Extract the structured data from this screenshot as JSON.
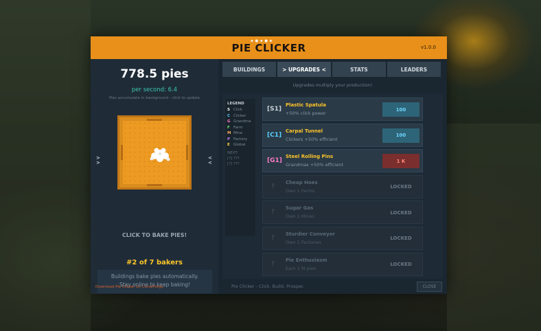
{
  "window": {
    "title": "PIE CLICKER",
    "version": "v1.0.0"
  },
  "left": {
    "pies": "778.5 pies",
    "per_second": "per second: 6.4",
    "background_note": "Pies accumulate in background - click to update",
    "bake_label": "CLICK TO BAKE PIES!",
    "rank": "#2 of 7 bakers",
    "info_line1": "Buildings bake pies automatically.",
    "info_line2": "Stay online to keep baking!"
  },
  "tabs": [
    {
      "label": "BUILDINGS"
    },
    {
      "label": "> UPGRADES <"
    },
    {
      "label": "STATS"
    },
    {
      "label": "LEADERS"
    }
  ],
  "subtitle": "Upgrades multiply your production!",
  "legend": {
    "title": "LEGEND",
    "items": [
      {
        "key": "S",
        "label": "Click",
        "color": "#ffffff"
      },
      {
        "key": "C",
        "label": "Clicker",
        "color": "#5ad0ff"
      },
      {
        "key": "G",
        "label": "Grandma",
        "color": "#ff7cc8"
      },
      {
        "key": "F",
        "label": "Farm",
        "color": "#6ee06e"
      },
      {
        "key": "M",
        "label": "Mine",
        "color": "#ffb060"
      },
      {
        "key": "P",
        "label": "Factory",
        "color": "#c080ff"
      },
      {
        "key": "E",
        "label": "Global",
        "color": "#ffd84a"
      }
    ],
    "next_title": "NEXT:",
    "next1": "[?] ???",
    "next2": "[?] ???"
  },
  "upgrades": [
    {
      "code": "[S1]",
      "name": "Plastic Spatula",
      "desc": "+50% click power",
      "cost": "100",
      "code_color": "#c8d0d8",
      "cost_bg": "#2e6478",
      "cost_color": "#6fd6ff",
      "locked": false
    },
    {
      "code": "[C1]",
      "name": "Carpal Tunnel",
      "desc": "Clickers +50% efficient",
      "cost": "100",
      "code_color": "#5ad0ff",
      "cost_bg": "#2e6478",
      "cost_color": "#6fd6ff",
      "locked": false
    },
    {
      "code": "[G1]",
      "name": "Steel Rolling Pins",
      "desc": "Grandmas +50% efficient",
      "cost": "1 K",
      "code_color": "#ff7cc8",
      "cost_bg": "#7a2e2e",
      "cost_color": "#ff8a7a",
      "locked": false
    },
    {
      "code": "?",
      "name": "Cheap Hoes",
      "desc": "Own 1 Farms",
      "cost": "LOCKED",
      "locked": true
    },
    {
      "code": "?",
      "name": "Sugar Gas",
      "desc": "Own 1 Mines",
      "cost": "LOCKED",
      "locked": true
    },
    {
      "code": "?",
      "name": "Sturdier Conveyor",
      "desc": "Own 1 Factories",
      "cost": "LOCKED",
      "locked": true
    },
    {
      "code": "?",
      "name": "Pie Enthusiasm",
      "desc": "Earn 1 M pies",
      "cost": "LOCKED",
      "locked": true
    }
  ],
  "footer": {
    "download": "Download Pie Clicker on CurseForge",
    "tagline": "Pie Clicker - Click. Build. Prosper.",
    "close": "CLOSE"
  },
  "colors": {
    "accent": "#e8901a",
    "upgrade_name": "#ffc52a"
  }
}
